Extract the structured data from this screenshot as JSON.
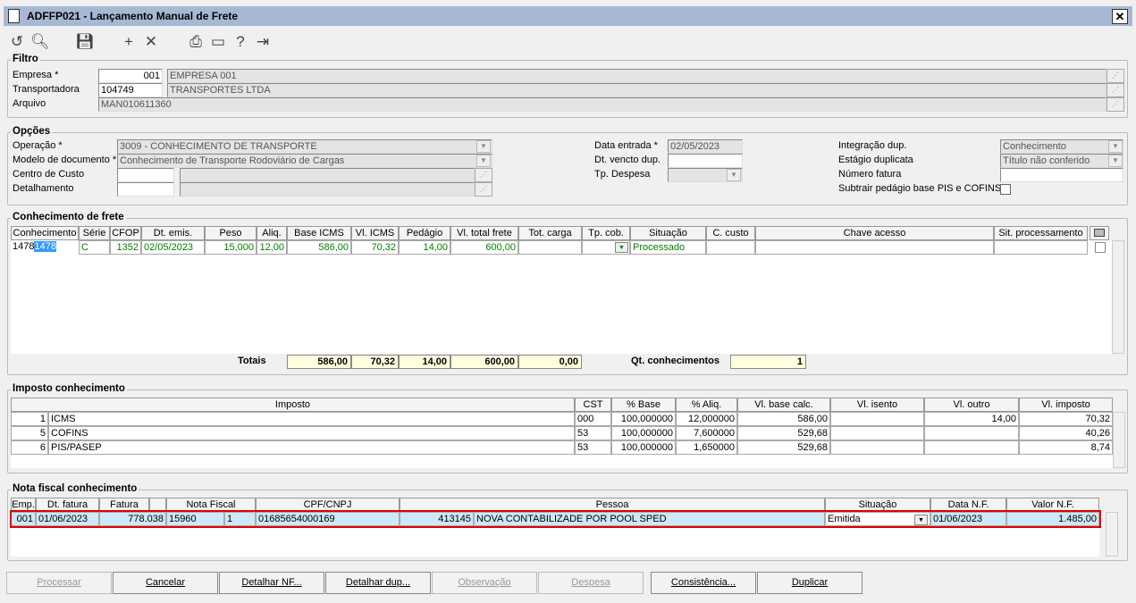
{
  "window": {
    "title": "ADFFP021 - Lançamento Manual de Frete",
    "close": "✕"
  },
  "toolbar": [
    {
      "icon": "undo-icon",
      "glyph": "↺"
    },
    {
      "icon": "search-icon",
      "glyph": "🔍︎"
    },
    {
      "icon": "save-icon",
      "glyph": "💾︎"
    },
    {
      "icon": "add-icon",
      "glyph": "+"
    },
    {
      "icon": "delete-icon",
      "glyph": "✕"
    },
    {
      "icon": "print-icon",
      "glyph": "⎙"
    },
    {
      "icon": "calendar-icon",
      "glyph": "▭"
    },
    {
      "icon": "help-icon",
      "glyph": "?"
    },
    {
      "icon": "exit-icon",
      "glyph": "⇥"
    }
  ],
  "filtro": {
    "title": "Filtro",
    "empresa_label": "Empresa *",
    "empresa_code": "001",
    "empresa_name": "EMPRESA 001",
    "transp_label": "Transportadora",
    "transp_code": "104749",
    "transp_name": "TRANSPORTES LTDA",
    "arquivo_label": "Arquivo",
    "arquivo": "MAN010611360"
  },
  "opcoes": {
    "title": "Opções",
    "operacao_label": "Operação *",
    "operacao": "3009 - CONHECIMENTO DE TRANSPORTE",
    "modelo_label": "Modelo de documento *",
    "modelo": "Conhecimento de Transporte Rodoviário de Cargas",
    "centro_label": "Centro de Custo",
    "detalhamento_label": "Detalhamento",
    "data_entrada_label": "Data entrada *",
    "data_entrada": "02/05/2023",
    "dt_vencto_label": "Dt. vencto dup.",
    "tp_despesa_label": "Tp. Despesa",
    "integracao_label": "Integração dup.",
    "integracao": "Conhecimento",
    "estagio_label": "Estágio duplicata",
    "estagio": "Título não conferido",
    "numero_fatura_label": "Número fatura",
    "subtrair_label": "Subtrair pedágio base PIS e COFINS",
    "subtrair_checked": false
  },
  "conhecimento": {
    "title": "Conhecimento de frete",
    "columns": [
      "Conhecimento",
      "Série",
      "CFOP",
      "Dt. emis.",
      "Peso",
      "Aliq.",
      "Base ICMS",
      "Vl. ICMS",
      "Pedágio",
      "Vl. total frete",
      "Tot. carga",
      "Tp. cob.",
      "Situação",
      "C. custo",
      "Chave acesso",
      "Sit. processamento",
      ""
    ],
    "rows": [
      [
        "1478",
        "C",
        "1352",
        "02/05/2023",
        "15,000",
        "12,00",
        "586,00",
        "70,32",
        "14,00",
        "600,00",
        "",
        "",
        "Processado",
        "",
        "",
        "",
        ""
      ]
    ],
    "totais_label": "Totais",
    "totais": [
      "586,00",
      "70,32",
      "14,00",
      "600,00",
      "0,00"
    ],
    "qt_label": "Qt. conhecimentos",
    "qt": "1"
  },
  "imposto": {
    "title": "Imposto conhecimento",
    "columns": [
      "Imposto",
      "CST",
      "% Base",
      "% Aliq.",
      "Vl. base calc.",
      "Vl. isento",
      "Vl. outro",
      "Vl. imposto"
    ],
    "rows": [
      [
        "1",
        "ICMS",
        "000",
        "100,000000",
        "12,000000",
        "586,00",
        "",
        "14,00",
        "70,32"
      ],
      [
        "5",
        "COFINS",
        "53",
        "100,000000",
        "7,600000",
        "529,68",
        "",
        "",
        "40,26"
      ],
      [
        "6",
        "PIS/PASEP",
        "53",
        "100,000000",
        "1,650000",
        "529,68",
        "",
        "",
        "8,74"
      ]
    ]
  },
  "nota": {
    "title": "Nota fiscal conhecimento",
    "columns": [
      "Emp.",
      "Dt. fatura",
      "Fatura",
      "",
      "Nota Fiscal",
      "CPF/CNPJ",
      "Pessoa",
      "Situação",
      "Data N.F.",
      "Valor N.F."
    ],
    "rows": [
      {
        "emp": "001",
        "dt_fatura": "01/06/2023",
        "fatura": "778.038",
        "nf": "15960",
        "serie": "1",
        "cpf": "01685654000169",
        "pessoa_code": "413145",
        "pessoa": "NOVA CONTABILIZADE POR POOL SPED",
        "situacao": "Emitida",
        "data_nf": "01/06/2023",
        "valor": "1.485,00"
      }
    ]
  },
  "buttons": [
    {
      "label": "Processar",
      "enabled": false
    },
    {
      "label": "Cancelar",
      "enabled": true
    },
    {
      "label": "Detalhar NF...",
      "enabled": true
    },
    {
      "label": "Detalhar dup...",
      "enabled": true
    },
    {
      "label": "Observação",
      "enabled": false
    },
    {
      "label": "Despesa",
      "enabled": false
    },
    {
      "label": "Consistência...",
      "enabled": true
    },
    {
      "label": "Duplicar",
      "enabled": true
    }
  ],
  "colors": {
    "titlebar": "#a7b8d4",
    "selection": "#3399ff",
    "row_highlight": "#cde8f8",
    "highlight_border": "#e00000",
    "green_text": "#008000",
    "totals_bg": "#ffffe0"
  }
}
